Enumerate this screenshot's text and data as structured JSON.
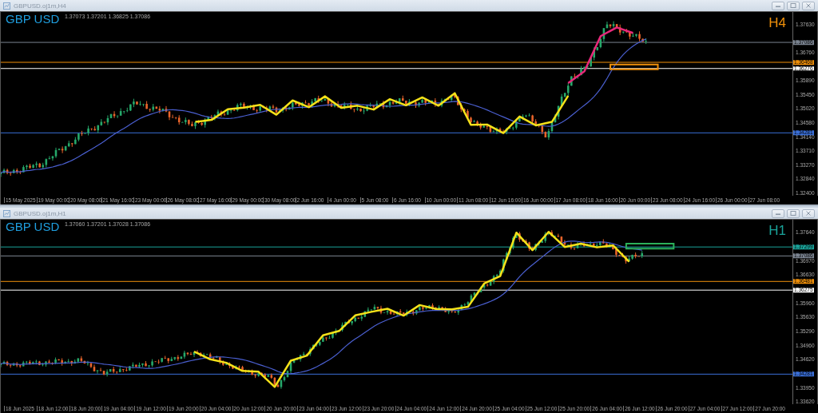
{
  "windows": [
    {
      "title": "GBPUSD.oj1m,H4",
      "quote": "1.37073 1.37201 1.36825 1.37086",
      "symbol": "GBP USD",
      "timeframe": "H4",
      "price_ticks": [
        "1.37630",
        "1.36760",
        "1.35890",
        "1.35450",
        "1.35020",
        "1.34580",
        "1.34140",
        "1.33710",
        "1.33270",
        "1.32840",
        "1.32400"
      ],
      "price_labels": [
        {
          "text": "1.37086",
          "color": "#7b8491"
        },
        {
          "text": "1.36468",
          "color": "#f0900a"
        },
        {
          "text": "1.36276",
          "color": "#ffffff"
        },
        {
          "text": "1.34281",
          "color": "#3a6fd8"
        }
      ],
      "time_labels": [
        "15 May 2025",
        "19 May 00:00",
        "20 May 08:00",
        "21 May 16:00",
        "23 May 00:00",
        "26 May 08:00",
        "27 May 16:00",
        "29 May 00:00",
        "30 May 08:00",
        "2 Jun 16:00",
        "4 Jun 00:00",
        "5 Jun 08:00",
        "6 Jun 16:00",
        "10 Jun 00:00",
        "11 Jun 08:00",
        "12 Jun 16:00",
        "16 Jun 00:00",
        "17 Jun 08:00",
        "18 Jun 16:00",
        "20 Jun 00:00",
        "23 Jun 08:00",
        "24 Jun 16:00",
        "26 Jun 00:00",
        "27 Jun 08:00"
      ]
    },
    {
      "title": "GBPUSD.oj1m,H1",
      "quote": "1.37060 1.37201 1.37028 1.37086",
      "symbol": "GBP USD",
      "timeframe": "H1",
      "price_ticks": [
        "1.37640",
        "1.36970",
        "1.36630",
        "1.35960",
        "1.35630",
        "1.35290",
        "1.34960",
        "1.34620",
        "1.33950",
        "1.33620"
      ],
      "price_labels": [
        {
          "text": "1.37299",
          "color": "#1aa39a"
        },
        {
          "text": "1.37086",
          "color": "#7b8491"
        },
        {
          "text": "1.36481",
          "color": "#f0900a"
        },
        {
          "text": "1.36275",
          "color": "#ffffff"
        },
        {
          "text": "1.34281",
          "color": "#3a6fd8"
        }
      ],
      "time_labels": [
        "18 Jun 2025",
        "18 Jun 12:00",
        "18 Jun 20:00",
        "19 Jun 04:00",
        "19 Jun 12:00",
        "19 Jun 20:00",
        "20 Jun 04:00",
        "20 Jun 12:00",
        "20 Jun 20:00",
        "23 Jun 04:00",
        "23 Jun 12:00",
        "23 Jun 20:00",
        "24 Jun 04:00",
        "24 Jun 12:00",
        "24 Jun 20:00",
        "25 Jun 04:00",
        "25 Jun 12:00",
        "25 Jun 20:00",
        "26 Jun 04:00",
        "26 Jun 12:00",
        "26 Jun 20:00",
        "27 Jun 04:00",
        "27 Jun 12:00",
        "27 Jun 20:00"
      ]
    }
  ]
}
